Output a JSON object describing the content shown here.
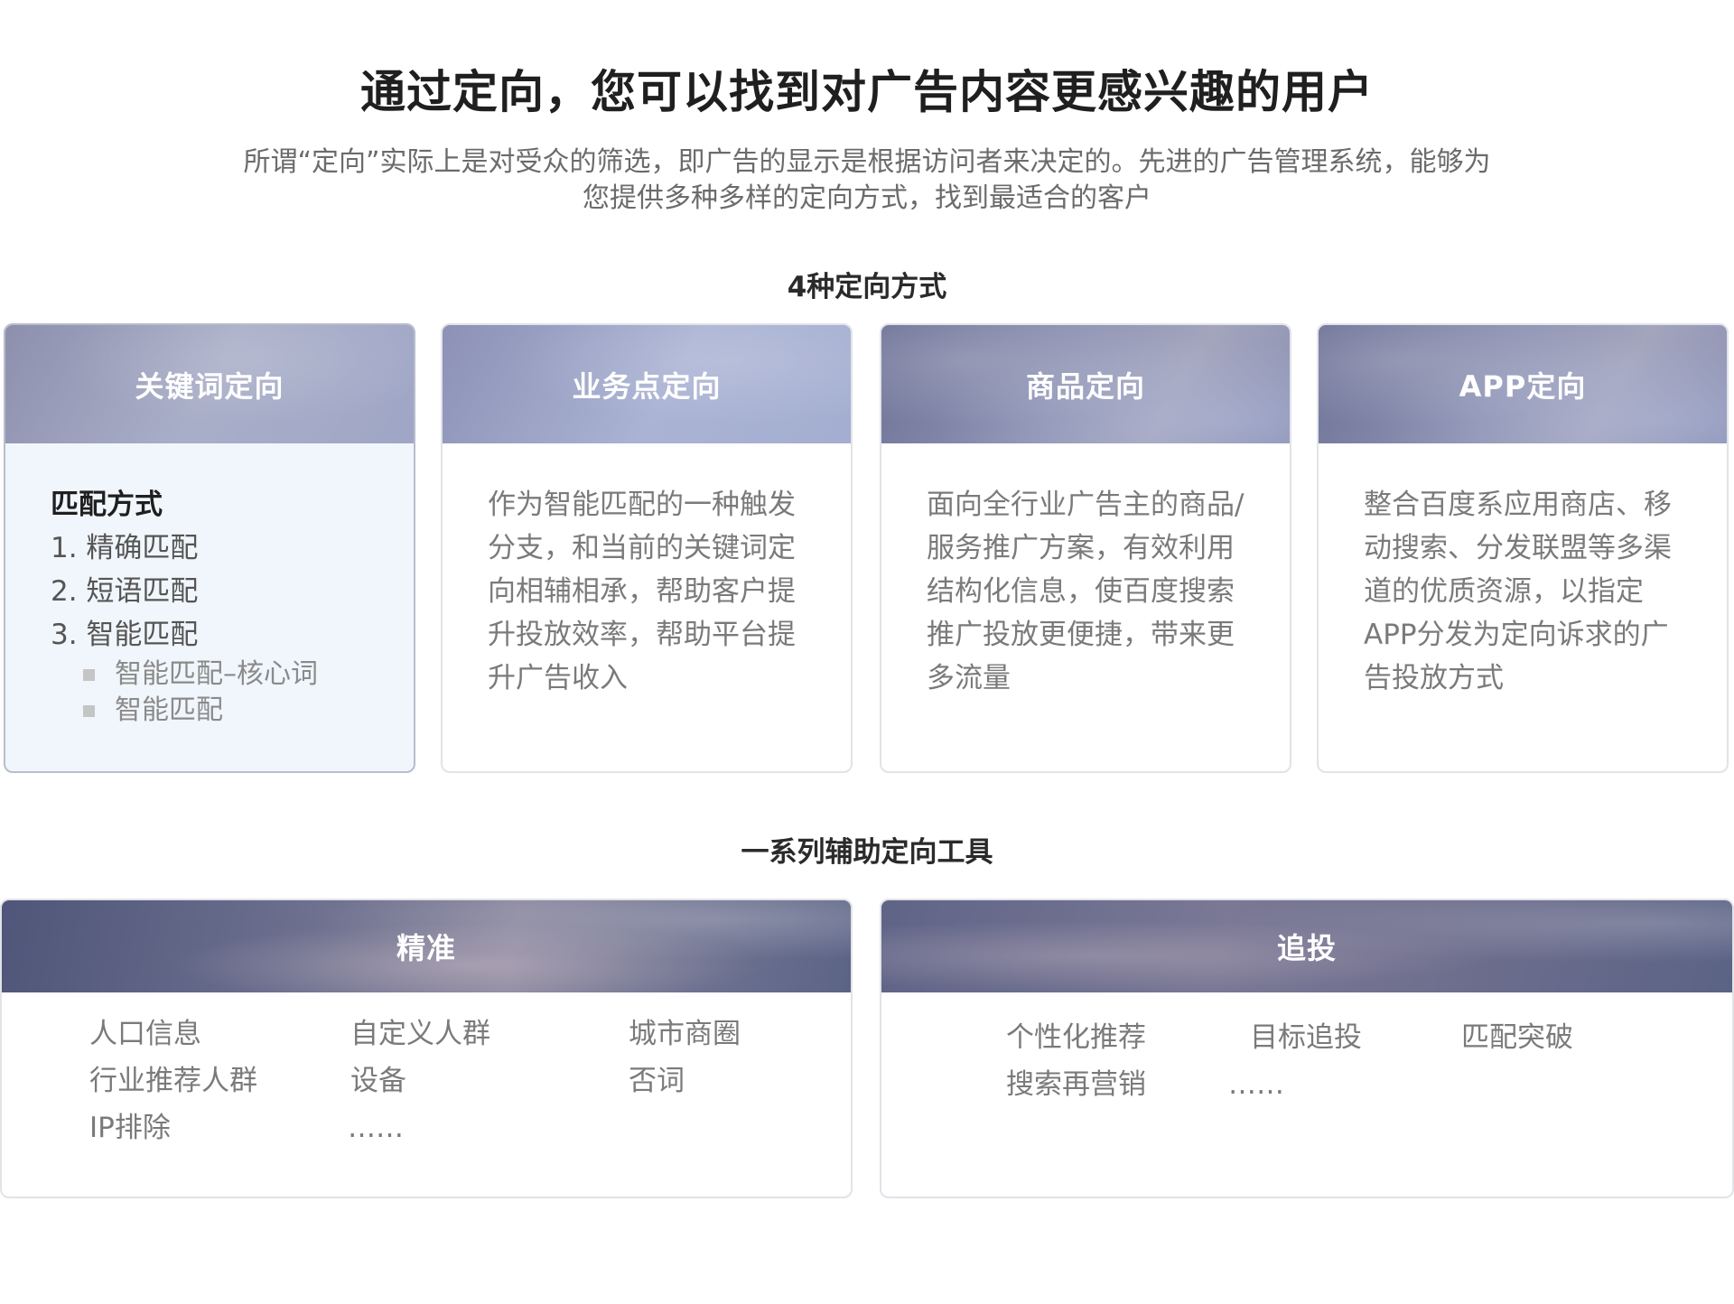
{
  "page": {
    "title": "通过定向，您可以找到对广告内容更感兴趣的用户",
    "intro_lines": [
      "所谓“定向”实际上是对受众的筛选，即广告的显示是根据访问者来决定的。先进的广告管理系统，能够为",
      "您提供多种多样的定向方式，找到最适合的客户"
    ]
  },
  "section_modes": {
    "title": "4种定向方式",
    "cards": [
      {
        "header": "关键词定向",
        "match_title": "匹配方式",
        "match_items": [
          "1. 精确匹配",
          "2. 短语匹配",
          "3. 智能匹配"
        ],
        "sub_items": [
          "智能匹配–核心词",
          "智能匹配"
        ]
      },
      {
        "header": "业务点定向",
        "lines": [
          "作为智能匹配的一种触发",
          "分支，和当前的关键词定",
          "向相辅相承，帮助客户提",
          "升投放效率，帮助平台提",
          "升广告收入"
        ]
      },
      {
        "header": "商品定向",
        "lines": [
          "面向全行业广告主的商品/",
          "服务推广方案，有效利用",
          "结构化信息，使百度搜索",
          "推广投放更便捷，带来更",
          "多流量"
        ]
      },
      {
        "header": "APP定向",
        "lines": [
          "整合百度系应用商店、移",
          "动搜索、分发联盟等多渠",
          "道的优质资源，以指定",
          "APP分发为定向诉求的广",
          "告投放方式"
        ]
      }
    ]
  },
  "section_tools": {
    "title": "一系列辅助定向工具",
    "panels": [
      {
        "header": "精准",
        "items": [
          "人口信息",
          "自定义人群",
          "城市商圈",
          "行业推荐人群",
          "设备",
          "否词",
          "IP排除",
          "……"
        ]
      },
      {
        "header": "追投",
        "items": [
          "个性化推荐",
          "目标追投",
          "匹配突破",
          "搜索再营销",
          "……"
        ]
      }
    ]
  },
  "colors": {
    "title_text": "#1f1f1f",
    "body_text": "#7a7a7a",
    "active_card_bg": "#f1f6fc",
    "card_border": "#e2e3e8"
  }
}
